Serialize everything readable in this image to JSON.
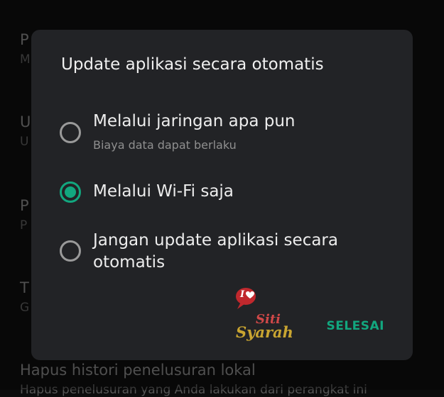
{
  "background": {
    "items": [
      {
        "title": "P",
        "subtitle": "M"
      },
      {
        "title": "U",
        "subtitle": "U"
      },
      {
        "title": "P",
        "subtitle": "P"
      },
      {
        "title": "T",
        "subtitle": "G"
      },
      {
        "title": "Hapus histori penelusuran lokal",
        "subtitle": "Hapus penelusuran yang Anda lakukan dari perangkat ini"
      }
    ]
  },
  "dialog": {
    "title": "Update aplikasi secara otomatis",
    "options": [
      {
        "label": "Melalui jaringan apa pun",
        "sublabel": "Biaya data dapat berlaku",
        "selected": false
      },
      {
        "label": "Melalui Wi-Fi saja",
        "sublabel": "",
        "selected": true
      },
      {
        "label": "Jangan update aplikasi secara otomatis",
        "sublabel": "",
        "selected": false
      }
    ],
    "done_label": "SELESAI"
  },
  "watermark": {
    "line1": "I",
    "line2": "Siti",
    "line3": "Syarah"
  },
  "colors": {
    "accent": "#12a77f",
    "dialog_bg": "#222326",
    "radio_off": "#9a9a9a"
  }
}
